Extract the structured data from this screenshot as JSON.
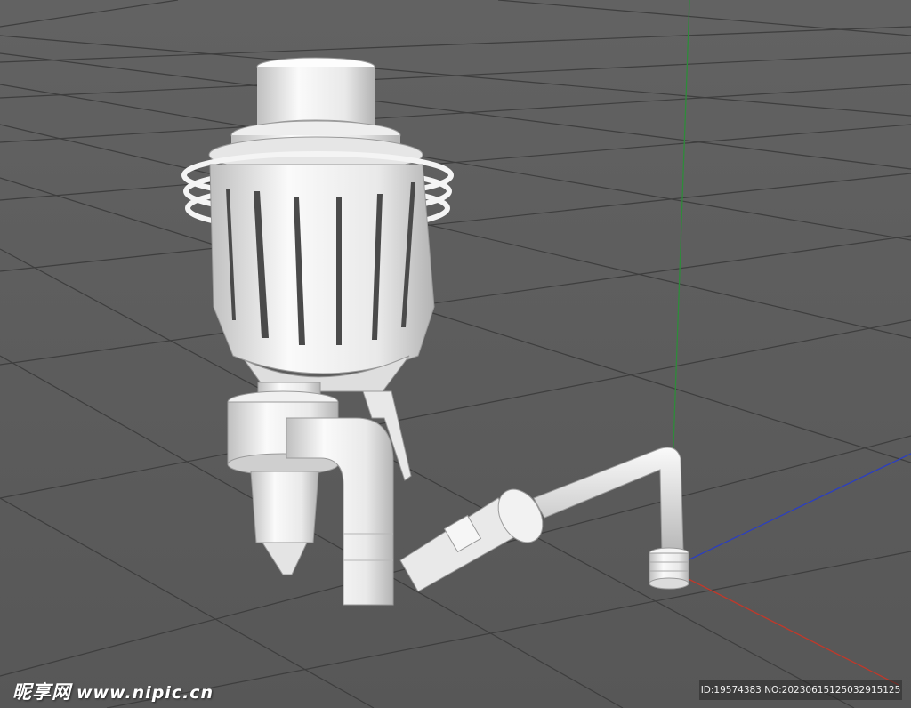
{
  "viewport": {
    "background": "#5a5a5a",
    "grid_color": "#3e3e3e",
    "model_color": "#f2f2f2",
    "axis_colors": {
      "x": "#c0392b",
      "y": "#2e8b3a",
      "z": "#2c3fbf"
    }
  },
  "watermark": {
    "site_name_cn": "昵享网",
    "site_url": "www.nipic.cn",
    "image_id": "ID:19574383 NO:20230615125032915125"
  }
}
